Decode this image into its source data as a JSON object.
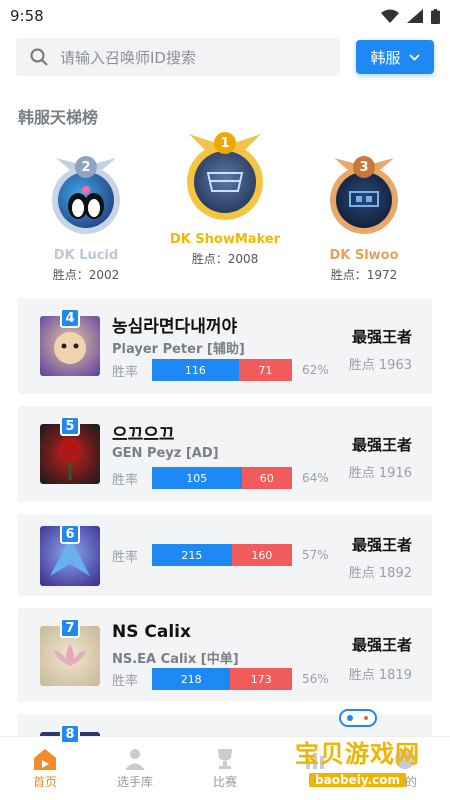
{
  "status": {
    "time": "9:58"
  },
  "search": {
    "placeholder": "请输入召唤师ID搜索"
  },
  "region": {
    "label": "韩服"
  },
  "section_title": "韩服天梯榜",
  "podium": [
    {
      "rank": "2",
      "name": "DK Lucid",
      "points": "胜点：2002",
      "name_color": "#b9c8de"
    },
    {
      "rank": "1",
      "name": "DK ShowMaker",
      "points": "胜点：2008",
      "name_color": "#f5b800"
    },
    {
      "rank": "3",
      "name": "DK Slwoo",
      "points": "胜点：1972",
      "name_color": "#e8a05a"
    }
  ],
  "players": [
    {
      "rank": "4",
      "name": "농심라면다내꺼야",
      "team": "Player Peter [辅助]",
      "win_label": "胜率",
      "wins": "116",
      "losses": "71",
      "win_pct": "62%",
      "tier": "最强王者",
      "points": "胜点 1963",
      "avatar_color": "#5a3fa0"
    },
    {
      "rank": "5",
      "name": "으끄으끄",
      "team": "GEN Peyz [AD]",
      "win_label": "胜率",
      "wins": "105",
      "losses": "60",
      "win_pct": "64%",
      "tier": "最强王者",
      "points": "胜点 1916",
      "avatar_color": "#5a1a1a"
    },
    {
      "rank": "6",
      "name": "",
      "team": "",
      "win_label": "胜率",
      "wins": "215",
      "losses": "160",
      "win_pct": "57%",
      "tier": "最强王者",
      "points": "胜点 1892",
      "avatar_color": "#3a4aa0"
    },
    {
      "rank": "7",
      "name": "NS Calix",
      "team": "NS.EA Calix [中单]",
      "win_label": "胜率",
      "wins": "218",
      "losses": "173",
      "win_pct": "56%",
      "tier": "最强王者",
      "points": "胜点 1819",
      "avatar_color": "#d8cbb0"
    },
    {
      "rank": "8",
      "name": "",
      "team": "",
      "win_label": "",
      "wins": "",
      "losses": "",
      "win_pct": "",
      "tier": "",
      "points": "",
      "avatar_color": "#2a3a6a"
    }
  ],
  "tabs": [
    {
      "label": "首页",
      "icon": "home-icon",
      "active": true
    },
    {
      "label": "选手库",
      "icon": "person-icon",
      "active": false
    },
    {
      "label": "比赛",
      "icon": "trophy-icon",
      "active": false
    },
    {
      "label": "",
      "icon": "chart-icon",
      "active": false
    },
    {
      "label": "我的",
      "icon": "user-icon",
      "active": false
    }
  ],
  "watermark": {
    "text": "宝贝游戏网",
    "url": "baobeiy.com"
  },
  "colors": {
    "accent": "#1e88f5",
    "loss": "#f25b5b",
    "active_tab": "#f28c28"
  }
}
